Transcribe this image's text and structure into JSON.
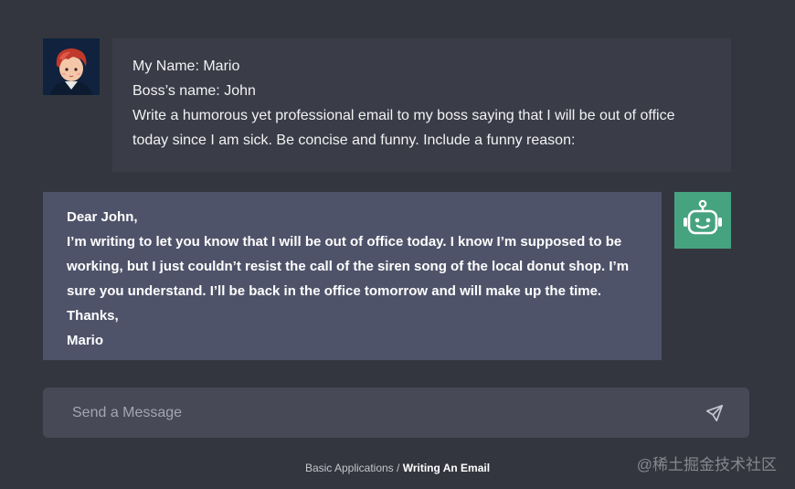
{
  "user_message": {
    "lines": [
      "My Name: Mario",
      "Boss’s name: John",
      "Write a humorous yet professional email to my boss saying that I will be out of office",
      "today since I am sick. Be concise and funny. Include a funny reason:"
    ]
  },
  "assistant_message": {
    "lines": [
      "Dear John,",
      "I’m writing to let you know that I will be out of office today. I know I’m supposed to be",
      "working, but I just couldn’t resist the call of the siren song of the local donut shop. I’m",
      "sure you understand. I’ll be back in the office tomorrow and will make up the time.",
      "Thanks,",
      "Mario"
    ]
  },
  "composer": {
    "placeholder": "Send a Message",
    "value": ""
  },
  "breadcrumb": {
    "parent": "Basic Applications",
    "separator": " / ",
    "current": "Writing An Email"
  },
  "watermark": "@稀土掘金技术社区",
  "colors": {
    "background": "#34363f",
    "user_bubble": "#3a3c47",
    "assistant_bubble": "#4f5369",
    "bot_avatar": "#46a380",
    "input": "#474a56"
  },
  "icons": {
    "user_avatar": "user-avatar-illustration",
    "bot_avatar": "robot-icon",
    "send": "send-icon"
  }
}
